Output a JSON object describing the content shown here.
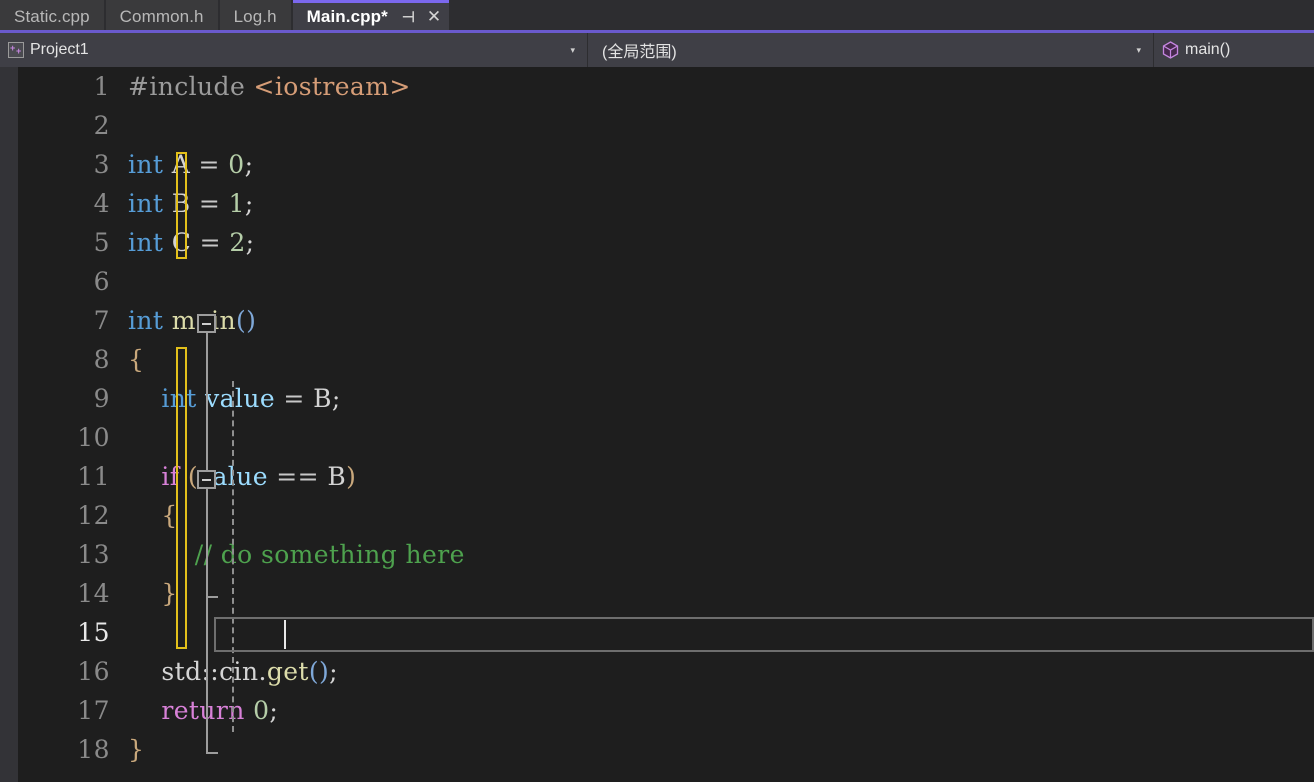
{
  "window": {
    "app": "Visual Studio",
    "theme_background": "#1e1e1e",
    "accent": "#7b68ee"
  },
  "tab_bar": {
    "tabs": [
      {
        "label": "Static.cpp",
        "active": false,
        "modified": false
      },
      {
        "label": "Common.h",
        "active": false,
        "modified": false
      },
      {
        "label": "Log.h",
        "active": false,
        "modified": false
      },
      {
        "label": "Main.cpp*",
        "active": true,
        "modified": true
      }
    ],
    "pin_icon": "pin-icon",
    "pin_glyph": "⊣",
    "close_icon": "close-icon",
    "close_glyph": "✕"
  },
  "nav_bar": {
    "project": {
      "icon": "cpp-project-icon",
      "label": "Project1",
      "caret": "▾"
    },
    "scope": {
      "label": "(全局范围)",
      "caret": "▾"
    },
    "member": {
      "icon": "method-cube-icon",
      "label": "main()"
    }
  },
  "editor": {
    "language": "cpp",
    "current_line": 15,
    "caret_column": 2,
    "lines": [
      {
        "n": 1,
        "tokens": [
          {
            "t": "#include ",
            "c": "t-pre"
          },
          {
            "t": "<iostream>",
            "c": "t-inc"
          }
        ]
      },
      {
        "n": 2,
        "tokens": []
      },
      {
        "n": 3,
        "tokens": [
          {
            "t": "int",
            "c": "t-kw"
          },
          {
            "t": " ",
            "c": "t-op"
          },
          {
            "t": "A",
            "c": "t-id"
          },
          {
            "t": " ",
            "c": "t-op"
          },
          {
            "t": "=",
            "c": "t-op"
          },
          {
            "t": " ",
            "c": "t-op"
          },
          {
            "t": "0",
            "c": "t-num"
          },
          {
            "t": ";",
            "c": "t-punc"
          }
        ]
      },
      {
        "n": 4,
        "tokens": [
          {
            "t": "int",
            "c": "t-kw"
          },
          {
            "t": " ",
            "c": "t-op"
          },
          {
            "t": "B",
            "c": "t-id"
          },
          {
            "t": " ",
            "c": "t-op"
          },
          {
            "t": "=",
            "c": "t-op"
          },
          {
            "t": " ",
            "c": "t-op"
          },
          {
            "t": "1",
            "c": "t-num"
          },
          {
            "t": ";",
            "c": "t-punc"
          }
        ]
      },
      {
        "n": 5,
        "tokens": [
          {
            "t": "int",
            "c": "t-kw"
          },
          {
            "t": " ",
            "c": "t-op"
          },
          {
            "t": "C",
            "c": "t-id"
          },
          {
            "t": " ",
            "c": "t-op"
          },
          {
            "t": "=",
            "c": "t-op"
          },
          {
            "t": " ",
            "c": "t-op"
          },
          {
            "t": "2",
            "c": "t-num"
          },
          {
            "t": ";",
            "c": "t-punc"
          }
        ]
      },
      {
        "n": 6,
        "tokens": []
      },
      {
        "n": 7,
        "tokens": [
          {
            "t": "int",
            "c": "t-kw"
          },
          {
            "t": " ",
            "c": "t-op"
          },
          {
            "t": "main",
            "c": "t-fn"
          },
          {
            "t": "()",
            "c": "t-paren"
          }
        ]
      },
      {
        "n": 8,
        "tokens": [
          {
            "t": "{",
            "c": "t-brace"
          }
        ]
      },
      {
        "n": 9,
        "tokens": [
          {
            "t": "    ",
            "c": "t-op"
          },
          {
            "t": "int",
            "c": "t-kw"
          },
          {
            "t": " ",
            "c": "t-op"
          },
          {
            "t": "value",
            "c": "t-var"
          },
          {
            "t": " ",
            "c": "t-op"
          },
          {
            "t": "=",
            "c": "t-op"
          },
          {
            "t": " ",
            "c": "t-op"
          },
          {
            "t": "B",
            "c": "t-id"
          },
          {
            "t": ";",
            "c": "t-punc"
          }
        ]
      },
      {
        "n": 10,
        "tokens": []
      },
      {
        "n": 11,
        "tokens": [
          {
            "t": "    ",
            "c": "t-op"
          },
          {
            "t": "if",
            "c": "t-ctl"
          },
          {
            "t": " ",
            "c": "t-op"
          },
          {
            "t": "(",
            "c": "t-brace"
          },
          {
            "t": "value",
            "c": "t-var"
          },
          {
            "t": " ",
            "c": "t-op"
          },
          {
            "t": "==",
            "c": "t-op"
          },
          {
            "t": " ",
            "c": "t-op"
          },
          {
            "t": "B",
            "c": "t-id"
          },
          {
            "t": ")",
            "c": "t-brace"
          }
        ]
      },
      {
        "n": 12,
        "tokens": [
          {
            "t": "    ",
            "c": "t-op"
          },
          {
            "t": "{",
            "c": "t-brace"
          }
        ]
      },
      {
        "n": 13,
        "tokens": [
          {
            "t": "        ",
            "c": "t-op"
          },
          {
            "t": "// do something here",
            "c": "t-cmt"
          }
        ]
      },
      {
        "n": 14,
        "tokens": [
          {
            "t": "    ",
            "c": "t-op"
          },
          {
            "t": "}",
            "c": "t-brace"
          }
        ]
      },
      {
        "n": 15,
        "tokens": []
      },
      {
        "n": 16,
        "tokens": [
          {
            "t": "    ",
            "c": "t-op"
          },
          {
            "t": "std",
            "c": "t-id"
          },
          {
            "t": "::",
            "c": "t-punc"
          },
          {
            "t": "cin",
            "c": "t-id"
          },
          {
            "t": ".",
            "c": "t-punc"
          },
          {
            "t": "get",
            "c": "t-fn"
          },
          {
            "t": "()",
            "c": "t-paren"
          },
          {
            "t": ";",
            "c": "t-punc"
          }
        ]
      },
      {
        "n": 17,
        "tokens": [
          {
            "t": "    ",
            "c": "t-op"
          },
          {
            "t": "return",
            "c": "t-ctl"
          },
          {
            "t": " ",
            "c": "t-op"
          },
          {
            "t": "0",
            "c": "t-num"
          },
          {
            "t": ";",
            "c": "t-punc"
          }
        ]
      },
      {
        "n": 18,
        "tokens": [
          {
            "t": "}",
            "c": "t-brace"
          }
        ]
      }
    ],
    "change_bars": [
      {
        "from_line": 3,
        "to_line": 5
      },
      {
        "from_line": 8,
        "to_line": 15
      }
    ],
    "fold_regions": [
      {
        "line": 7,
        "to_line": 18,
        "state": "expanded",
        "glyph": "minus"
      },
      {
        "line": 11,
        "to_line": 14,
        "state": "expanded",
        "glyph": "minus"
      }
    ],
    "indent_guides": [
      {
        "col": 1,
        "from_line": 9,
        "to_line": 17
      }
    ],
    "colors": {
      "background": "#1e1e1e",
      "indicator_margin": "#333337",
      "line_number": "#8a8a8a",
      "line_number_active": "#e8e8e8",
      "change_bar": "#e3c01b",
      "fold_glyph": "#9d9d9d",
      "indent_guide": "#8f8f8f",
      "current_line_border": "#6e6e6e",
      "keyword": "#569cd6",
      "control_keyword": "#d881d8",
      "function": "#dcdcaa",
      "local_variable": "#9cdcfe",
      "number": "#b5cea8",
      "comment": "#4ea24e",
      "preprocessor": "#9b9b9b",
      "include_path": "#d69d77",
      "identifier": "#d4d4d4"
    }
  }
}
